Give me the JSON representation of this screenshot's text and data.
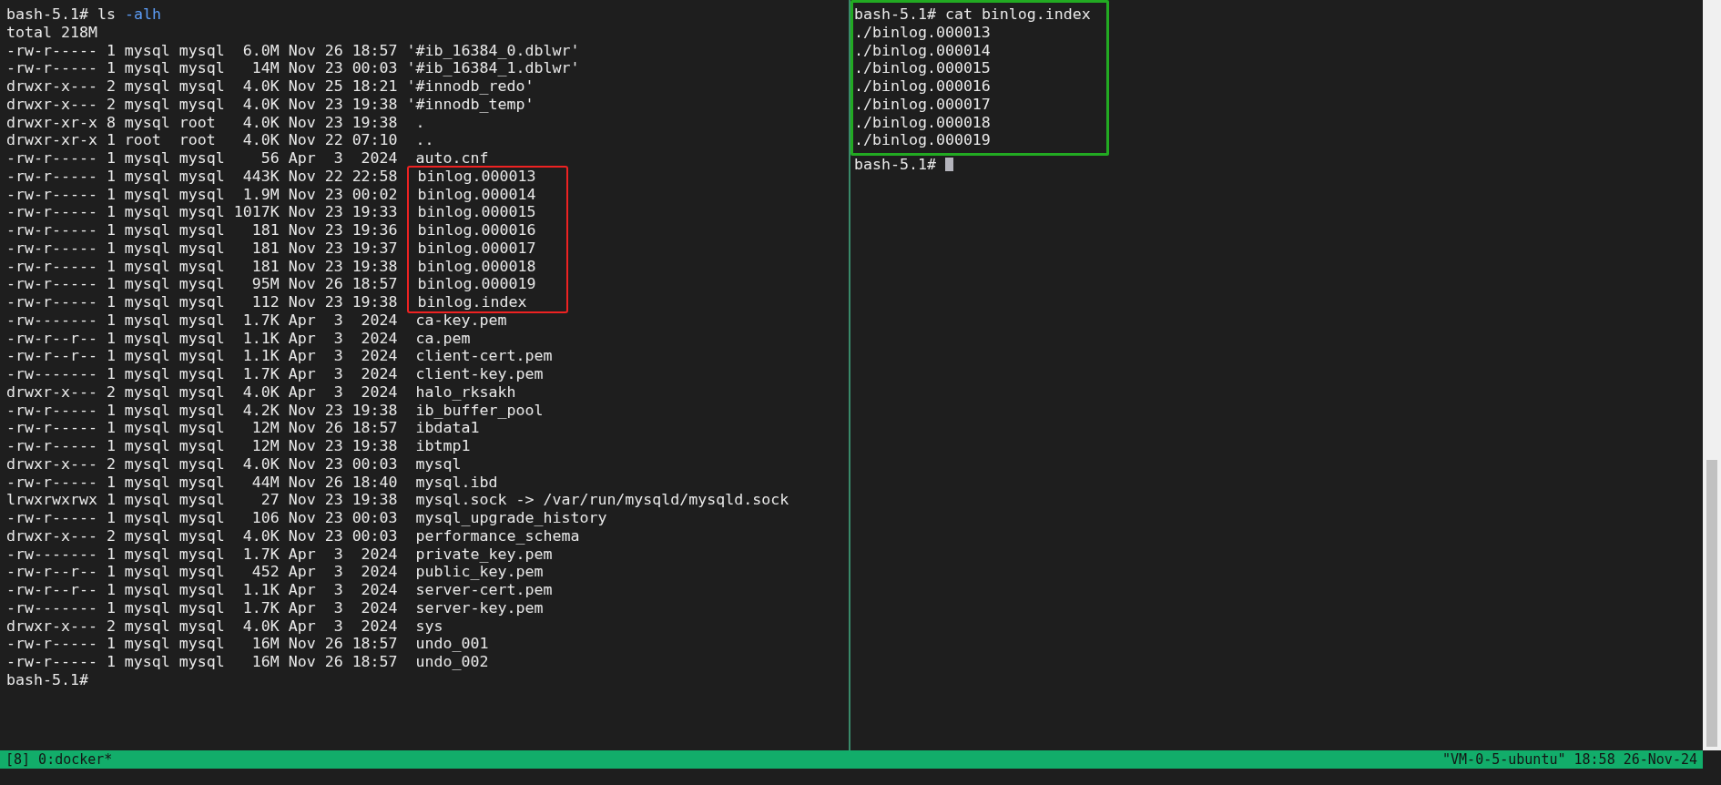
{
  "left_pane": {
    "lines": [
      {
        "kind": "command",
        "prompt": "bash-5.1#",
        "command": "ls",
        "args": "-alh"
      },
      {
        "kind": "output",
        "text": "total 218M"
      },
      {
        "kind": "entry",
        "info": "-rw-r----- 1 mysql mysql  6.0M Nov 26 18:57",
        "name": "'#ib_16384_0.dblwr'",
        "highlighted": false
      },
      {
        "kind": "entry",
        "info": "-rw-r----- 1 mysql mysql   14M Nov 23 00:03",
        "name": "'#ib_16384_1.dblwr'",
        "highlighted": false
      },
      {
        "kind": "entry",
        "info": "drwxr-x--- 2 mysql mysql  4.0K Nov 25 18:21",
        "name": "'#innodb_redo'",
        "highlighted": false
      },
      {
        "kind": "entry",
        "info": "drwxr-x--- 2 mysql mysql  4.0K Nov 23 19:38",
        "name": "'#innodb_temp'",
        "highlighted": false
      },
      {
        "kind": "entry",
        "info": "drwxr-xr-x 8 mysql root   4.0K Nov 23 19:38",
        "name": " .",
        "highlighted": false
      },
      {
        "kind": "entry",
        "info": "drwxr-xr-x 1 root  root   4.0K Nov 22 07:10",
        "name": " ..",
        "highlighted": false
      },
      {
        "kind": "entry",
        "info": "-rw-r----- 1 mysql mysql    56 Apr  3  2024",
        "name": " auto.cnf",
        "highlighted": false
      },
      {
        "kind": "entry",
        "info": "-rw-r----- 1 mysql mysql  443K Nov 22 22:58",
        "name": " binlog.000013",
        "highlighted": true
      },
      {
        "kind": "entry",
        "info": "-rw-r----- 1 mysql mysql  1.9M Nov 23 00:02",
        "name": " binlog.000014",
        "highlighted": true
      },
      {
        "kind": "entry",
        "info": "-rw-r----- 1 mysql mysql 1017K Nov 23 19:33",
        "name": " binlog.000015",
        "highlighted": true
      },
      {
        "kind": "entry",
        "info": "-rw-r----- 1 mysql mysql   181 Nov 23 19:36",
        "name": " binlog.000016",
        "highlighted": true
      },
      {
        "kind": "entry",
        "info": "-rw-r----- 1 mysql mysql   181 Nov 23 19:37",
        "name": " binlog.000017",
        "highlighted": true
      },
      {
        "kind": "entry",
        "info": "-rw-r----- 1 mysql mysql   181 Nov 23 19:38",
        "name": " binlog.000018",
        "highlighted": true
      },
      {
        "kind": "entry",
        "info": "-rw-r----- 1 mysql mysql   95M Nov 26 18:57",
        "name": " binlog.000019",
        "highlighted": true
      },
      {
        "kind": "entry",
        "info": "-rw-r----- 1 mysql mysql   112 Nov 23 19:38",
        "name": " binlog.index",
        "highlighted": true
      },
      {
        "kind": "entry",
        "info": "-rw------- 1 mysql mysql  1.7K Apr  3  2024",
        "name": " ca-key.pem",
        "highlighted": false
      },
      {
        "kind": "entry",
        "info": "-rw-r--r-- 1 mysql mysql  1.1K Apr  3  2024",
        "name": " ca.pem",
        "highlighted": false
      },
      {
        "kind": "entry",
        "info": "-rw-r--r-- 1 mysql mysql  1.1K Apr  3  2024",
        "name": " client-cert.pem",
        "highlighted": false
      },
      {
        "kind": "entry",
        "info": "-rw------- 1 mysql mysql  1.7K Apr  3  2024",
        "name": " client-key.pem",
        "highlighted": false
      },
      {
        "kind": "entry",
        "info": "drwxr-x--- 2 mysql mysql  4.0K Apr  3  2024",
        "name": " halo_rksakh",
        "highlighted": false
      },
      {
        "kind": "entry",
        "info": "-rw-r----- 1 mysql mysql  4.2K Nov 23 19:38",
        "name": " ib_buffer_pool",
        "highlighted": false
      },
      {
        "kind": "entry",
        "info": "-rw-r----- 1 mysql mysql   12M Nov 26 18:57",
        "name": " ibdata1",
        "highlighted": false
      },
      {
        "kind": "entry",
        "info": "-rw-r----- 1 mysql mysql   12M Nov 23 19:38",
        "name": " ibtmp1",
        "highlighted": false
      },
      {
        "kind": "entry",
        "info": "drwxr-x--- 2 mysql mysql  4.0K Nov 23 00:03",
        "name": " mysql",
        "highlighted": false
      },
      {
        "kind": "entry",
        "info": "-rw-r----- 1 mysql mysql   44M Nov 26 18:40",
        "name": " mysql.ibd",
        "highlighted": false
      },
      {
        "kind": "entry",
        "info": "lrwxrwxrwx 1 mysql mysql    27 Nov 23 19:38",
        "name": " mysql.sock -> /var/run/mysqld/mysqld.sock",
        "highlighted": false
      },
      {
        "kind": "entry",
        "info": "-rw-r----- 1 mysql mysql   106 Nov 23 00:03",
        "name": " mysql_upgrade_history",
        "highlighted": false
      },
      {
        "kind": "entry",
        "info": "drwxr-x--- 2 mysql mysql  4.0K Nov 23 00:03",
        "name": " performance_schema",
        "highlighted": false
      },
      {
        "kind": "entry",
        "info": "-rw------- 1 mysql mysql  1.7K Apr  3  2024",
        "name": " private_key.pem",
        "highlighted": false
      },
      {
        "kind": "entry",
        "info": "-rw-r--r-- 1 mysql mysql   452 Apr  3  2024",
        "name": " public_key.pem",
        "highlighted": false
      },
      {
        "kind": "entry",
        "info": "-rw-r--r-- 1 mysql mysql  1.1K Apr  3  2024",
        "name": " server-cert.pem",
        "highlighted": false
      },
      {
        "kind": "entry",
        "info": "-rw------- 1 mysql mysql  1.7K Apr  3  2024",
        "name": " server-key.pem",
        "highlighted": false
      },
      {
        "kind": "entry",
        "info": "drwxr-x--- 2 mysql mysql  4.0K Apr  3  2024",
        "name": " sys",
        "highlighted": false
      },
      {
        "kind": "entry",
        "info": "-rw-r----- 1 mysql mysql   16M Nov 26 18:57",
        "name": " undo_001",
        "highlighted": false
      },
      {
        "kind": "entry",
        "info": "-rw-r----- 1 mysql mysql   16M Nov 26 18:57",
        "name": " undo_002",
        "highlighted": false
      },
      {
        "kind": "prompt",
        "prompt": "bash-5.1#"
      }
    ]
  },
  "right_pane": {
    "highlight_frame": {
      "lines": [
        {
          "kind": "command",
          "prompt": "bash-5.1#",
          "command": "cat binlog.index"
        },
        {
          "kind": "output",
          "text": "./binlog.000013"
        },
        {
          "kind": "output",
          "text": "./binlog.000014"
        },
        {
          "kind": "output",
          "text": "./binlog.000015"
        },
        {
          "kind": "output",
          "text": "./binlog.000016"
        },
        {
          "kind": "output",
          "text": "./binlog.000017"
        },
        {
          "kind": "output",
          "text": "./binlog.000018"
        },
        {
          "kind": "output",
          "text": "./binlog.000019"
        }
      ]
    },
    "lines": [
      {
        "kind": "prompt",
        "prompt": "bash-5.1#",
        "cursor": true
      }
    ]
  },
  "status_bar": {
    "session": "[8] 0:docker*",
    "host_info": "\"VM-0-5-ubuntu\" 18:58 26-Nov-24"
  }
}
